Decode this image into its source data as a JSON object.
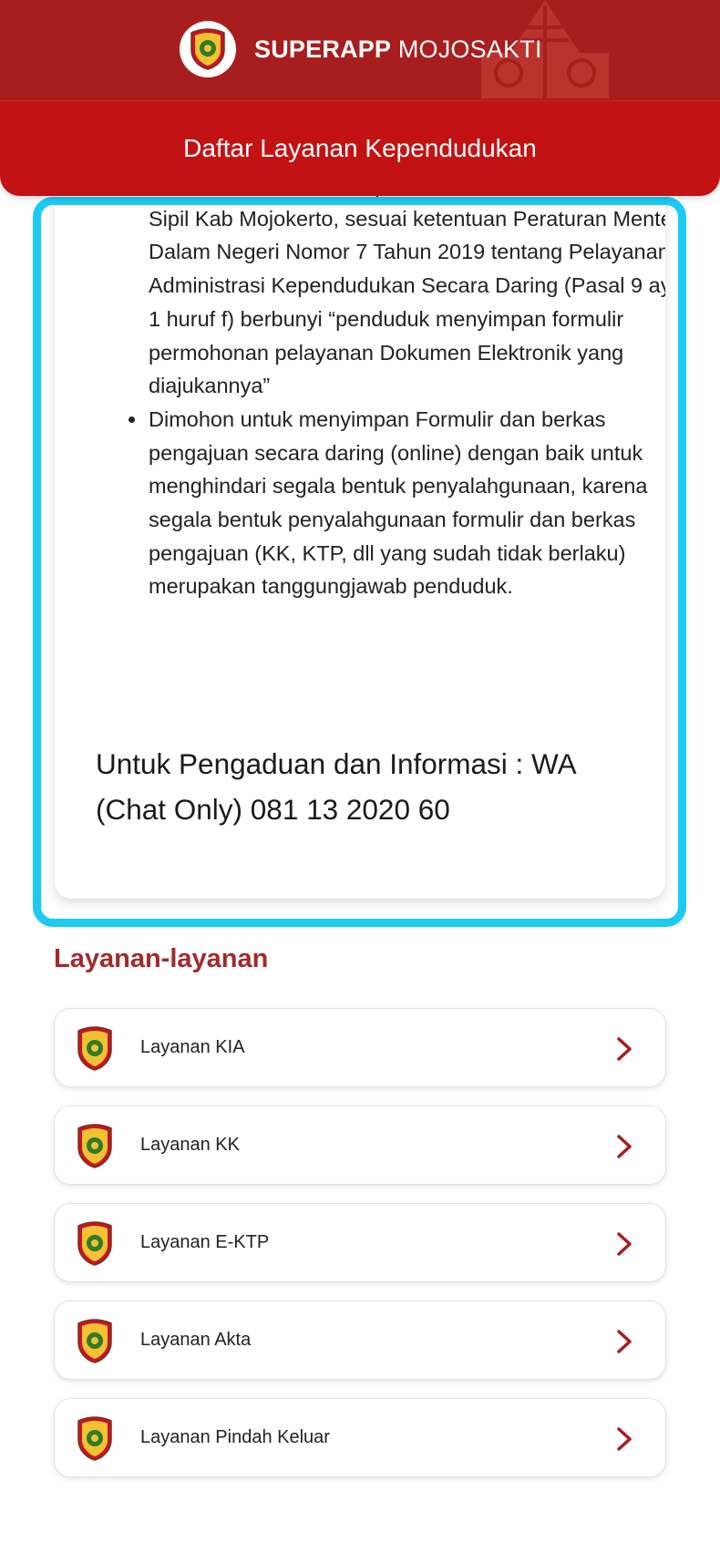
{
  "app": {
    "brand_bold": "SUPERAPP",
    "brand_rest": " MOJOSAKTI"
  },
  "page": {
    "title": "Daftar Layanan Kependudukan"
  },
  "info": {
    "items": [
      "diserahkan ke Dinas Kependudukan dan Pencatatan Sipil Kab Mojokerto, sesuai ketentuan Peraturan Menteri Dalam Negeri Nomor 7 Tahun 2019 tentang Pelayanan Administrasi Kependudukan Secara Daring (Pasal 9 ayat 1 huruf f) berbunyi “penduduk menyimpan formulir permohonan pelayanan Dokumen Elektronik yang diajukannya”",
      "Dimohon untuk menyimpan Formulir dan berkas pengajuan secara daring (online) dengan baik untuk menghindari segala bentuk penyalahgunaan, karena segala bentuk penyalahgunaan formulir dan berkas pengajuan (KK, KTP, dll yang sudah tidak berlaku) merupakan tanggungjawab penduduk."
    ],
    "contact": "Untuk Pengaduan dan Informasi : WA (Chat Only) 081 13 2020 60"
  },
  "services": {
    "title": "Layanan-layanan",
    "items": [
      {
        "label": "Layanan KIA"
      },
      {
        "label": "Layanan KK"
      },
      {
        "label": "Layanan E-KTP"
      },
      {
        "label": "Layanan Akta"
      },
      {
        "label": "Layanan Pindah Keluar"
      }
    ]
  },
  "colors": {
    "appbar": "#a81d1e",
    "titlebar": "#c21213",
    "highlight": "#1ccaf2",
    "section_title": "#a22a2b",
    "chevron": "#a81d1e"
  },
  "icons": {
    "brand": "mojokerto-emblem-icon",
    "service": "mojokerto-emblem-icon",
    "chevron": "chevron-right-icon"
  }
}
